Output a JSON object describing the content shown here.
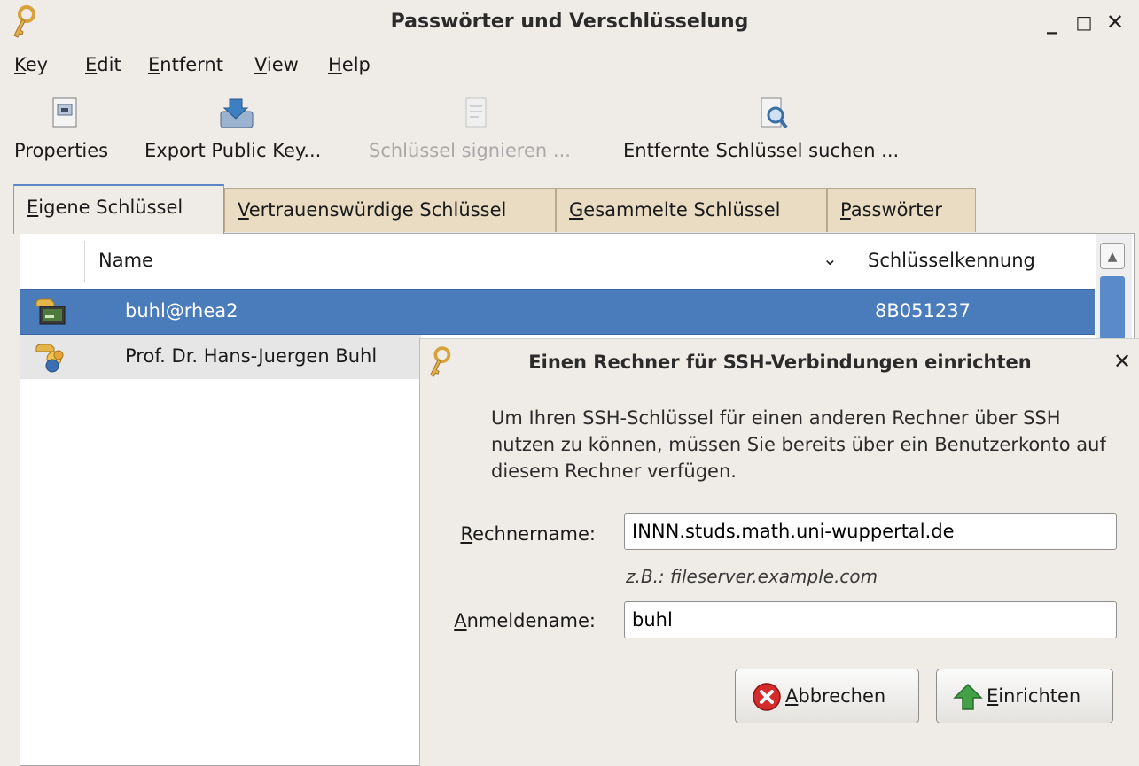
{
  "window": {
    "title": "Passwörter und Verschlüsselung",
    "controls": {
      "minimize": "_",
      "maximize": "□",
      "close": "✕"
    }
  },
  "menubar": {
    "items": [
      {
        "mnemonic": "K",
        "rest": "ey"
      },
      {
        "mnemonic": "E",
        "rest": "dit"
      },
      {
        "mnemonic": "E",
        "rest": "ntfernt"
      },
      {
        "mnemonic": "V",
        "rest": "iew"
      },
      {
        "mnemonic": "H",
        "rest": "elp"
      }
    ]
  },
  "toolbar": {
    "properties": "Properties",
    "export": "Export Public Key...",
    "sign": "Schlüssel signieren ...",
    "remote_search": "Entfernte Schlüssel suchen ..."
  },
  "tabs": [
    {
      "mnemonic": "E",
      "rest": "igene Schlüssel"
    },
    {
      "mnemonic": "V",
      "rest": "ertrauenswürdige Schlüssel"
    },
    {
      "mnemonic": "G",
      "rest": "esammelte Schlüssel"
    },
    {
      "mnemonic": "P",
      "rest": "asswörter"
    }
  ],
  "keylist": {
    "columns": {
      "name": "Name",
      "sort_indicator": "⌄",
      "key_id": "Schlüsselkennung"
    },
    "rows": [
      {
        "name": "buhl@rhea2",
        "key_id": "8B051237"
      },
      {
        "name": "Prof. Dr. Hans-Juergen Buhl",
        "key_id": ""
      }
    ]
  },
  "dialog": {
    "title": "Einen Rechner für SSH-Verbindungen einrichten",
    "close": "✕",
    "message": "Um Ihren SSH-Schlüssel für einen anderen Rechner über SSH nutzen zu können, müssen Sie bereits über ein Benutzerkonto auf diesem Rechner verfügen.",
    "host_label": {
      "mnemonic": "R",
      "rest": "echnername:"
    },
    "host_value": "INNN.studs.math.uni-wuppertal.de",
    "host_hint": "z.B.: fileserver.example.com",
    "user_label": {
      "mnemonic": "A",
      "rest": "nmeldename:"
    },
    "user_value": "buhl",
    "cancel": {
      "mnemonic": "A",
      "rest": "bbrechen"
    },
    "ok": {
      "mnemonic": "E",
      "rest": "inrichten"
    }
  },
  "colors": {
    "window_bg": "#efebe7",
    "selection": "#4a7cbb",
    "tab_inactive": "#e9dcc3",
    "cancel_icon": "#d42b2b",
    "ok_icon": "#43a047"
  }
}
